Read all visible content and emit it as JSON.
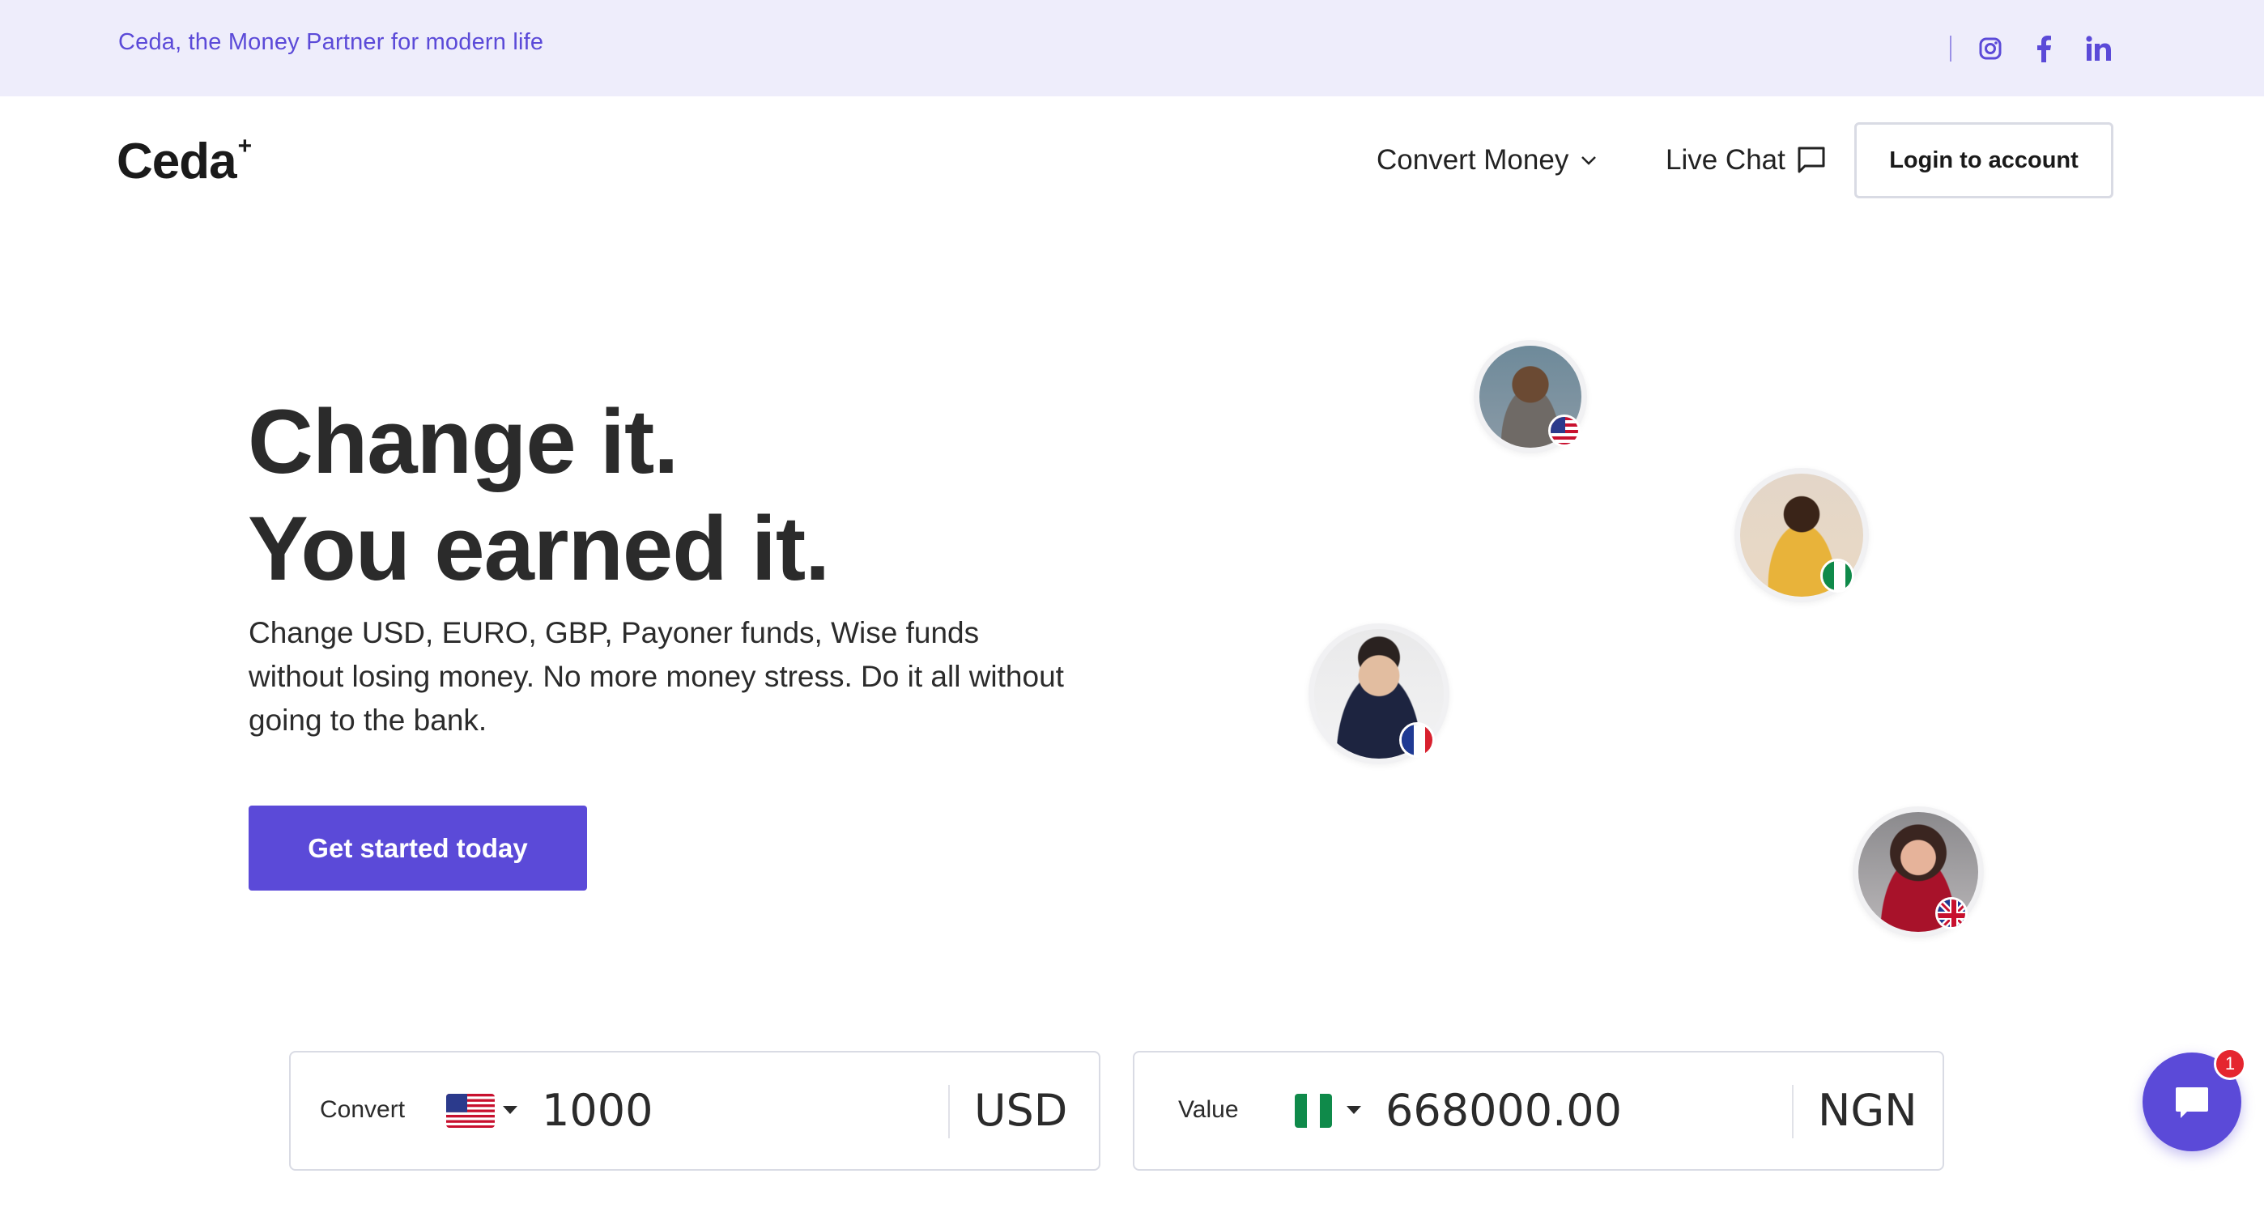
{
  "topbar": {
    "tagline": "Ceda, the Money Partner for modern life",
    "socials": [
      "instagram-icon",
      "facebook-icon",
      "linkedin-icon"
    ]
  },
  "nav": {
    "logo": "Ceda",
    "logo_mark": "+",
    "convert_money": "Convert Money",
    "live_chat": "Live Chat",
    "login": "Login to account"
  },
  "hero": {
    "title_line1": "Change it.",
    "title_line2": "You earned it.",
    "subtitle": "Change USD, EURO, GBP, Payoner funds, Wise funds without losing money. No more money stress. Do it all without going to the bank.",
    "cta": "Get started today"
  },
  "converter": {
    "from": {
      "label": "Convert",
      "amount": "1000",
      "currency": "USD",
      "flag": "us-flag"
    },
    "to": {
      "label": "Value",
      "amount": "668000.00",
      "currency": "NGN",
      "flag": "ng-flag"
    }
  },
  "chat_widget": {
    "badge": "1"
  },
  "colors": {
    "brand": "#5b4ad8",
    "topbar_bg": "#eeedfb",
    "badge": "#e5262f"
  }
}
